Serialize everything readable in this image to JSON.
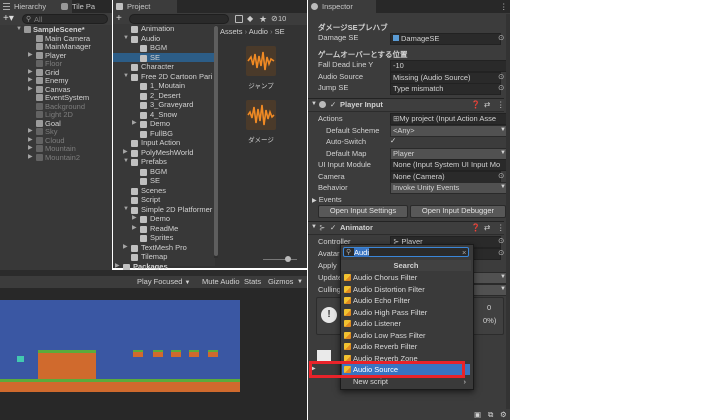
{
  "hierarchy": {
    "tab_label": "Hierarchy",
    "tile_tab_label": "Tile Pa",
    "search_placeholder": "All",
    "items": [
      {
        "label": "SampleScene*",
        "indent": 0,
        "expanded": true
      },
      {
        "label": "Main Camera",
        "indent": 1
      },
      {
        "label": "MainManager",
        "indent": 1
      },
      {
        "label": "Player",
        "indent": 1,
        "expandable": true
      },
      {
        "label": "Floor",
        "indent": 1,
        "disabled": true
      },
      {
        "label": "Grid",
        "indent": 1,
        "expandable": true
      },
      {
        "label": "Enemy",
        "indent": 1,
        "expandable": true
      },
      {
        "label": "Canvas",
        "indent": 1,
        "expandable": true
      },
      {
        "label": "EventSystem",
        "indent": 1
      },
      {
        "label": "Background",
        "indent": 1,
        "disabled": true
      },
      {
        "label": "Light 2D",
        "indent": 1,
        "disabled": true
      },
      {
        "label": "Goal",
        "indent": 1
      },
      {
        "label": "Sky",
        "indent": 1,
        "expandable": true,
        "disabled": true
      },
      {
        "label": "Cloud",
        "indent": 1,
        "expandable": true,
        "disabled": true
      },
      {
        "label": "Mountain",
        "indent": 1,
        "expandable": true,
        "disabled": true
      },
      {
        "label": "Mountain2",
        "indent": 1,
        "expandable": true,
        "disabled": true
      }
    ]
  },
  "project": {
    "tab_label": "Project",
    "plus_label": "+",
    "badge_count": "10",
    "tree": [
      {
        "label": "Animation",
        "indent": 1
      },
      {
        "label": "Audio",
        "indent": 1,
        "expanded": true
      },
      {
        "label": "BGM",
        "indent": 2
      },
      {
        "label": "SE",
        "indent": 2,
        "selected": true
      },
      {
        "label": "Character",
        "indent": 1
      },
      {
        "label": "Free 2D Cartoon Pari",
        "indent": 1,
        "expanded": true
      },
      {
        "label": "1_Moutain",
        "indent": 2
      },
      {
        "label": "2_Desert",
        "indent": 2
      },
      {
        "label": "3_Graveyard",
        "indent": 2
      },
      {
        "label": "4_Snow",
        "indent": 2
      },
      {
        "label": "Demo",
        "indent": 2,
        "expandable": true
      },
      {
        "label": "FullBG",
        "indent": 2
      },
      {
        "label": "Input Action",
        "indent": 1
      },
      {
        "label": "PolyMeshWorld",
        "indent": 1,
        "expandable": true
      },
      {
        "label": "Prefabs",
        "indent": 1,
        "expanded": true
      },
      {
        "label": "BGM",
        "indent": 2
      },
      {
        "label": "SE",
        "indent": 2
      },
      {
        "label": "Scenes",
        "indent": 1
      },
      {
        "label": "Script",
        "indent": 1
      },
      {
        "label": "Simple 2D Platformer",
        "indent": 1,
        "expanded": true
      },
      {
        "label": "Demo",
        "indent": 2,
        "expandable": true
      },
      {
        "label": "ReadMe",
        "indent": 2,
        "expandable": true
      },
      {
        "label": "Sprites",
        "indent": 2
      },
      {
        "label": "TextMesh Pro",
        "indent": 1,
        "expandable": true
      },
      {
        "label": "Tilemap",
        "indent": 1
      }
    ],
    "packages_label": "Packages",
    "breadcrumb": [
      "Assets",
      "Audio",
      "SE"
    ],
    "assets": [
      {
        "label": "ジャンプ"
      },
      {
        "label": "ダメージ"
      }
    ]
  },
  "game_view": {
    "play_focused_label": "Play Focused",
    "mute_label": "Mute Audio",
    "stats_label": "Stats",
    "gizmos_label": "Gizmos"
  },
  "inspector": {
    "tab_label": "Inspector",
    "se_section_title": "ダメージSEプレハブ",
    "damage_se_label": "Damage SE",
    "damage_se_value": "DamageSE",
    "gameover_section_title": "ゲームオーバーとする位置",
    "fall_dead_label": "Fall Dead Line Y",
    "fall_dead_value": "-10",
    "audio_source_label": "Audio Source",
    "audio_source_value": "Missing (Audio Source)",
    "jump_se_label": "Jump SE",
    "jump_se_value": "Type mismatch",
    "player_input": {
      "title": "Player Input",
      "actions_label": "Actions",
      "actions_value": "My project (Input Action Asse",
      "default_scheme_label": "Default Scheme",
      "default_scheme_value": "<Any>",
      "auto_switch_label": "Auto-Switch",
      "auto_switch_checked": true,
      "default_map_label": "Default Map",
      "default_map_value": "Player",
      "ui_input_label": "UI Input Module",
      "ui_input_value": "None (Input System UI Input Mo",
      "camera_label": "Camera",
      "camera_value": "None (Camera)",
      "behavior_label": "Behavior",
      "behavior_value": "Invoke Unity Events",
      "events_label": "Events",
      "open_settings_label": "Open Input Settings",
      "open_debugger_label": "Open Input Debugger"
    },
    "animator": {
      "title": "Animator",
      "controller_label": "Controller",
      "controller_value": "Player",
      "avatar_label": "Avatar",
      "apply_label": "Apply",
      "update_label": "Update",
      "culling_label": "Culling",
      "info_tail_1": "0",
      "info_tail_2": "0%)"
    }
  },
  "add_component_popup": {
    "search_value": "Audi",
    "header": "Search",
    "items": [
      "Audio Chorus Filter",
      "Audio Distortion Filter",
      "Audio Echo Filter",
      "Audio High Pass Filter",
      "Audio Listener",
      "Audio Low Pass Filter",
      "Audio Reverb Filter",
      "Audio Reverb Zone",
      "Audio Source",
      "New script"
    ],
    "selected_item": "Audio Source",
    "highlight_color": "#e8232a"
  },
  "colors": {
    "selection": "#2c5d87",
    "popup_selection": "#3874c2",
    "game_bg": "#3a57a3",
    "ground_orange": "#d06a2d",
    "ground_green": "#5bab3c",
    "audio_waveform": "#f08a24"
  }
}
